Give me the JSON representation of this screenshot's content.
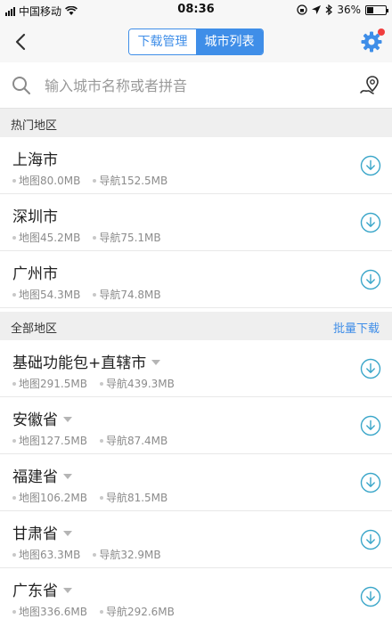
{
  "status": {
    "carrier": "中国移动",
    "time": "08:36",
    "battery": "36%",
    "battery_level": 0.36
  },
  "nav": {
    "tabs": [
      {
        "label": "下载管理",
        "active": false
      },
      {
        "label": "城市列表",
        "active": true
      }
    ]
  },
  "search": {
    "placeholder": "输入城市名称或者拼音"
  },
  "hot": {
    "title": "热门地区",
    "items": [
      {
        "name": "上海市",
        "map": "地图80.0MB",
        "nav": "导航152.5MB"
      },
      {
        "name": "深圳市",
        "map": "地图45.2MB",
        "nav": "导航75.1MB"
      },
      {
        "name": "广州市",
        "map": "地图54.3MB",
        "nav": "导航74.8MB"
      }
    ]
  },
  "all": {
    "title": "全部地区",
    "action": "批量下载",
    "items": [
      {
        "name": "基础功能包+直辖市",
        "map": "地图291.5MB",
        "nav": "导航439.3MB"
      },
      {
        "name": "安徽省",
        "map": "地图127.5MB",
        "nav": "导航87.4MB"
      },
      {
        "name": "福建省",
        "map": "地图106.2MB",
        "nav": "导航81.5MB"
      },
      {
        "name": "甘肃省",
        "map": "地图63.3MB",
        "nav": "导航32.9MB"
      },
      {
        "name": "广东省",
        "map": "地图336.6MB",
        "nav": "导航292.6MB"
      }
    ]
  },
  "colors": {
    "accent": "#3f8ee8",
    "download_icon": "#3aa6c9",
    "badge": "#f03e3e"
  }
}
